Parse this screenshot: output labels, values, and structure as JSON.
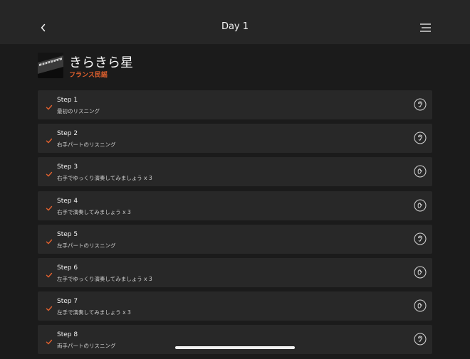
{
  "header": {
    "title": "Day 1",
    "back_icon": "chevron-left-icon",
    "menu_icon": "menu-icon"
  },
  "song": {
    "title": "きらきら星",
    "subtitle": "フランス民謡",
    "accent_color": "#e2612e"
  },
  "steps": [
    {
      "label": "Step 1",
      "desc": "最初のリスニング",
      "mode": "listen",
      "completed": true
    },
    {
      "label": "Step 2",
      "desc": "右手パートのリスニング",
      "mode": "listen",
      "completed": true
    },
    {
      "label": "Step 3",
      "desc": "右手でゆっくり演奏してみましょう x 3",
      "mode": "play",
      "completed": true
    },
    {
      "label": "Step 4",
      "desc": "右手で演奏してみましょう x 3",
      "mode": "play",
      "completed": true
    },
    {
      "label": "Step 5",
      "desc": "左手パートのリスニング",
      "mode": "listen",
      "completed": true
    },
    {
      "label": "Step 6",
      "desc": "左手でゆっくり演奏してみましょう x 3",
      "mode": "play",
      "completed": true
    },
    {
      "label": "Step 7",
      "desc": "左手で演奏してみましょう x 3",
      "mode": "play",
      "completed": true
    },
    {
      "label": "Step 8",
      "desc": "両手パートのリスニング",
      "mode": "listen",
      "completed": true
    }
  ]
}
